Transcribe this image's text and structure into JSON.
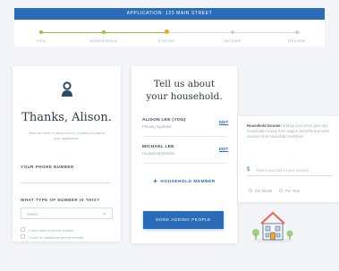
{
  "header": {
    "title": "APPLICATION: 123 MAIN STREET"
  },
  "steps": [
    {
      "label": "YOU",
      "state": "done"
    },
    {
      "label": "HOUSEHOLD",
      "state": "done"
    },
    {
      "label": "STATUS",
      "state": "active"
    },
    {
      "label": "INCOME",
      "state": "todo"
    },
    {
      "label": "REVIEW",
      "state": "todo"
    }
  ],
  "left_panel": {
    "greeting": "Thanks, Alison.",
    "subtext": "Now we need to know how to contact you about your application.",
    "phone_label": "YOUR PHONE NUMBER",
    "number_type_label": "WHAT TYPE OF NUMBER IS THIS?",
    "select_value": "Select",
    "checks": [
      "I don't have a phone number",
      "I have an additional phone number"
    ]
  },
  "household": {
    "title_line1": "Tell us about",
    "title_line2": "your household.",
    "members": [
      {
        "name": "ALISON LEE (YOU)",
        "role": "Primary Applicant",
        "edit": "EDIT"
      },
      {
        "name": "MICHAEL LEE",
        "role": "Household Member",
        "edit": "EDIT"
      }
    ],
    "add_label": "HOUSEHOLD MEMBER",
    "add_symbol": "+",
    "done_label": "DONE ADDING PEOPLE"
  },
  "income_panel": {
    "hint_bold": "Household income:",
    "hint_rest": "add up your gross (pre-tax) household income from wages, benefits and other sources from household members.",
    "currency": "$",
    "placeholder": "Total household income amount",
    "options": [
      "Per Month",
      "Per Year"
    ]
  },
  "colors": {
    "primary": "#2b6cb8",
    "done": "#8cc63f",
    "active": "#f5a623"
  }
}
